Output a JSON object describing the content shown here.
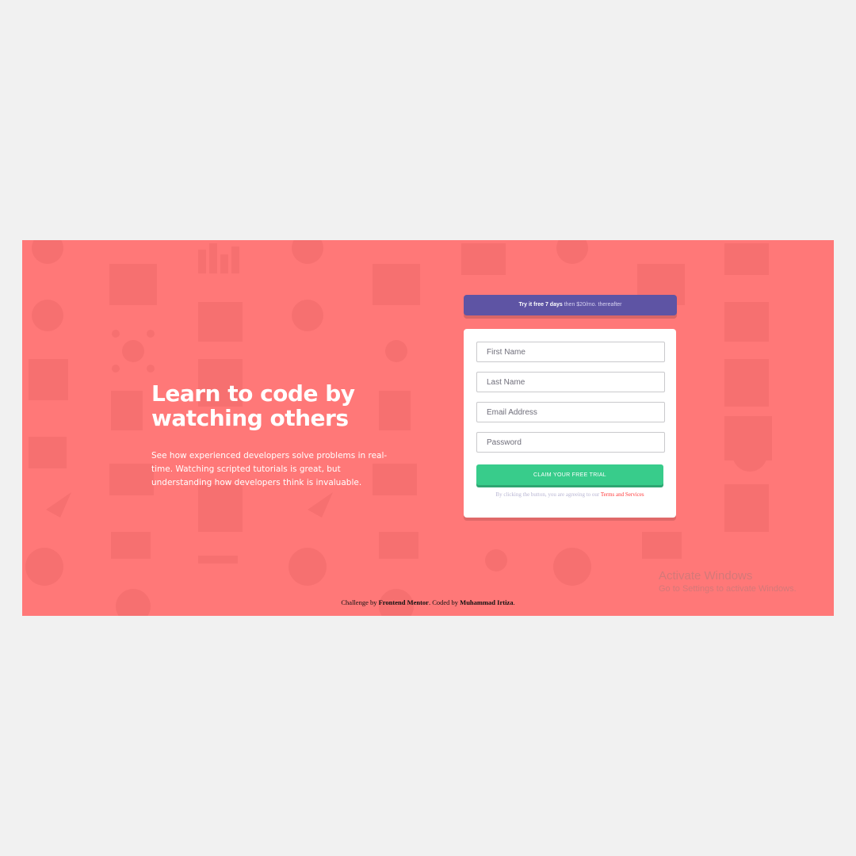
{
  "hero": {
    "heading_line1": "Learn to code by",
    "heading_line2": "watching others",
    "description": "See how experienced developers solve problems in real-time. Watching scripted tutorials is great, but understanding how developers think is invaluable."
  },
  "promo": {
    "bold_text": "Try it free 7 days",
    "light_text": "then $20/mo. thereafter"
  },
  "form": {
    "first_name_placeholder": "First Name",
    "last_name_placeholder": "Last Name",
    "email_placeholder": "Email Address",
    "password_placeholder": "Password",
    "submit_label": "CLAIM YOUR FREE TRIAL",
    "terms_prefix": "By clicking the button, you are agreeing to our",
    "terms_link": "Terms and Services"
  },
  "attribution": {
    "prefix": "Challenge by",
    "frontend_mentor": "Frontend Mentor",
    "middle": ". Coded by",
    "author": "Muhammad Irtiza",
    "suffix": "."
  },
  "watermark": {
    "line1": "Activate Windows",
    "line2": "Go to Settings to activate Windows."
  },
  "colors": {
    "page_bg": "#f1f1f1",
    "hero_bg": "#ff7878",
    "promo_bg": "#5e54a4",
    "cta_bg": "#38cc8b",
    "link": "#ff3b3b"
  },
  "icons": [
    "headset-icon",
    "toolbox-icon",
    "rocket-icon",
    "gear-icon",
    "key-icon",
    "bar-chart-icon",
    "browser-window-icon",
    "network-icon",
    "cart-icon",
    "lifebuoy-icon"
  ]
}
